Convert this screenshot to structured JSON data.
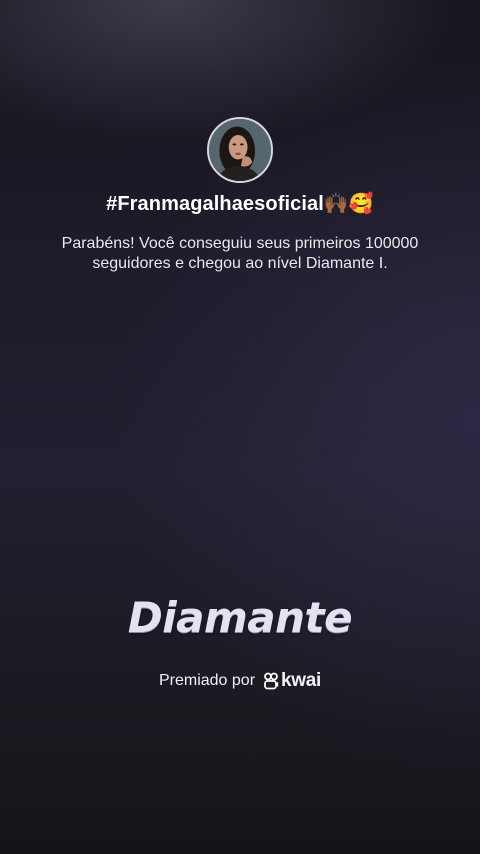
{
  "profile": {
    "username": "#Franmagalhaesoficial🙌🏾🥰"
  },
  "message": "Parabéns! Você conseguiu seus primeiros 100000 seguidores e chegou ao nível Diamante I.",
  "level": {
    "title": "Diamante"
  },
  "award": {
    "label": "Premiado por",
    "brand": "kwai",
    "brand_icon": "kwai-logo-icon"
  }
}
